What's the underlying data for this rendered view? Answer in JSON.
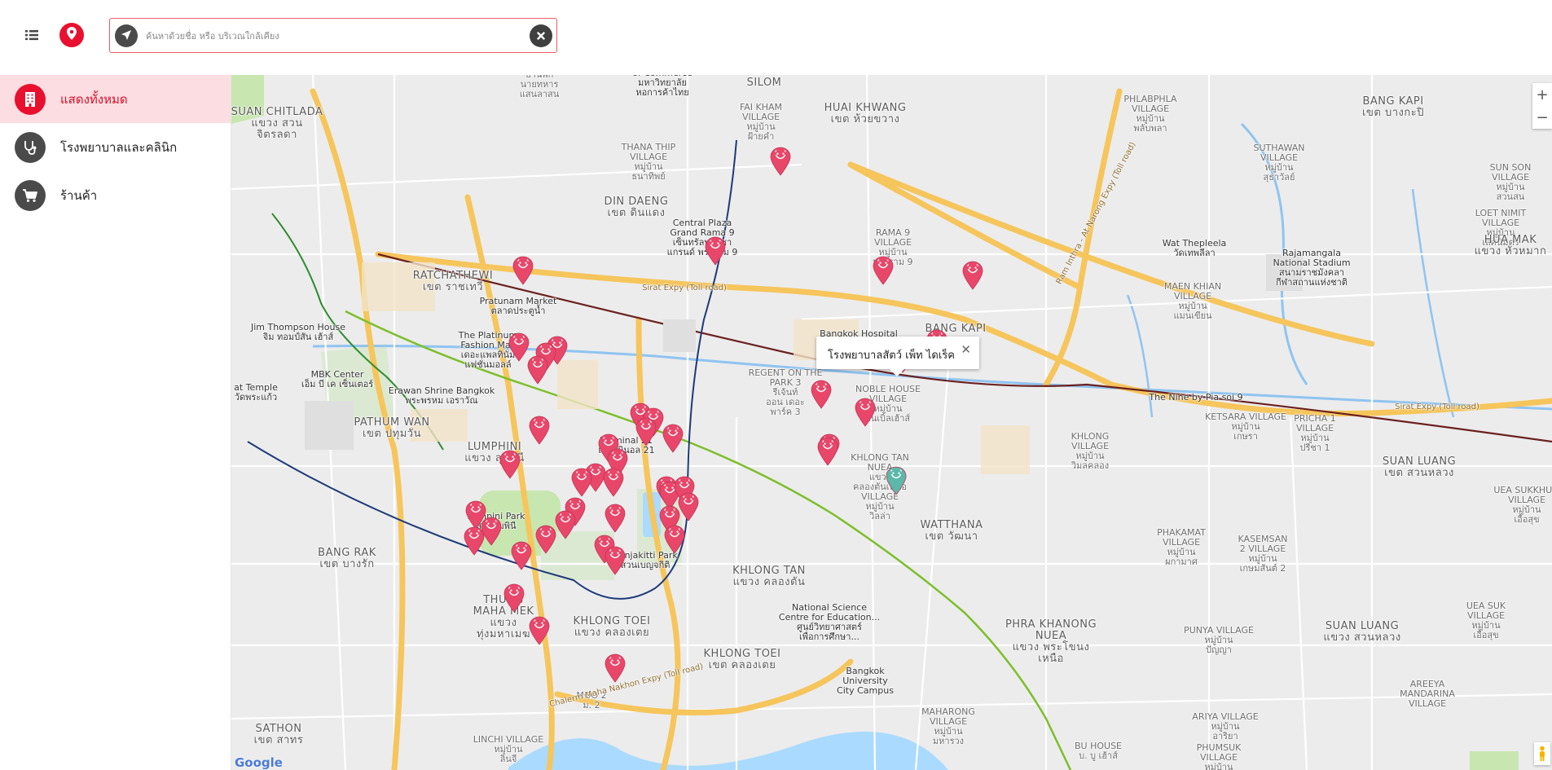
{
  "header": {
    "search_placeholder": "ค้นหาด้วยชื่อ หรือ บริเวณใกล้เคียง"
  },
  "sidebar": {
    "items": [
      {
        "label": "แสดงทั้งหมด",
        "icon": "building-icon",
        "active": true
      },
      {
        "label": "โรงพยาบาลและคลินิก",
        "icon": "stethoscope-icon",
        "active": false
      },
      {
        "label": "ร้านค้า",
        "icon": "cart-icon",
        "active": false
      }
    ]
  },
  "map": {
    "info_window_title": "โรงพยาบาลสัตว์ เพ็ท ไดเร็ค",
    "zoom_in": "+",
    "zoom_out": "−",
    "logo": "Google",
    "colors": {
      "marker": "#e8476a",
      "marker_selected": "#5cb8a8",
      "brand": "#e8102e",
      "highway": "#f6c55b",
      "water": "#aadaff"
    },
    "labels": {
      "silom": "SILOM",
      "village_top": "VILLAGE\nบ้านพัก\nนายทหาร\nแสนลาสน",
      "of_commerce": "of Commerce\nมหาวิทยาลัย\nหอการค้าไทย",
      "fai_kham": "FAI KHAM\nVILLAGE\nหมู่บ้าน\nฝ้ายคำ",
      "huai_khwang": "HUAI KHWANG\nเขต ห้วยขวาง",
      "phlabphla": "PHLABPHLA\nVILLAGE\nหมู่บ้าน\nพลับพลา",
      "bang_kapi_top": "BANG KAPI\nเขต บางกะปิ",
      "suan_chitlada": "SUAN CHITLADA\nแขวง สวน\nจิตรลดา",
      "thana_thip": "THANA THIP\nVILLAGE\nหมู่บ้าน\nธนาทิพย์",
      "suthawan": "SUTHAWAN\nVILLAGE\nหมู่บ้าน\nสุธาวัลย์",
      "sun_son": "SUN SON\nVILLAGE\nหมู่บ้าน\nสวนสน",
      "loet_nimit": "LOET NIMIT\nVILLAGE\nหมู่บ้าน\nเลิศนิมิตร",
      "din_daeng": "DIN DAENG\nเขต ดินแดง",
      "central_plaza": "Central Plaza\nGrand Rama 9\nเซ็นทรัลพลาซา\nแกรนด์ พระราม 9",
      "rama9_village": "RAMA 9\nVILLAGE\nหมู่บ้าน\nพระราม 9",
      "wat_thepleela": "Wat Thepleela\nวัดเทพลีลา",
      "rajamangala": "Rajamangala\nNational Stadium\nสนามราชมังคลา\nกีฬาสถานแห่งชาติ",
      "hua_mak": "HUA MAK\nแขวง หัวหมาก",
      "ratchathewi": "RATCHATHEWI\nเขต ราชเทวี",
      "pratunam": "Pratunam Market\nตลาดประตูน้ำ",
      "maen_khian": "MAEN KHIAN\nVILLAGE\nหมู่บ้าน\nแมนเขียน",
      "jim_thompson": "Jim Thompson House\nจิม ทอมป์สัน เฮ้าส์",
      "platinum": "The Platinum\nFashion Mall\nเดอะแพลทินั่ม\nแฟชั่นมอลล์",
      "bangkok_hospital": "Bangkok Hospital",
      "bang_kapi_mid": "BANG KAPI",
      "mbk": "MBK Center\nเอ็ม บี เค เซ็นเตอร์",
      "erawan": "Erawan Shrine Bangkok\nพระพรหม เอราวัณ",
      "regent": "REGENT ON THE\nPARK 3\nรีเจ้นท์\nออน เดอะ\nพาร์ค 3",
      "noble_house": "NOBLE HOUSE\nVILLAGE\nหมู่บ้าน\nโนเบิ้ลเฮ้าส์",
      "the_nine": "The Nine by Pia soi 9",
      "ketsara": "KETSARA VILLAGE\nหมู่บ้าน\nเกษรา",
      "pricha": "PRICHA 1\nVILLAGE\nหมู่บ้าน\nปรีชา 1",
      "suan_luang_top": "SUAN LUANG\nเขต สวนหลวง",
      "pathum_wan": "PATHUM WAN\nเขต ปทุมวัน",
      "lumphini": "LUMPHINI\nแขวง ลุมพินี",
      "terminal21": "Terminal 21\nเทอร์มินอล 21",
      "khlong_nuea": "KHLONG TAN\nNUEA\nแขวง\nคลองตันเหนือ\nVILLAGE\nหมู่บ้าน\nวิลล่า",
      "khlong_village": "KHLONG\nVILLAGE\nหมู่บ้าน\nวิมลคลอง",
      "ua_sukkhum": "UEA SUKKHUM\nVILLAGE\nหมู่บ้าน\nเอื้อสุข",
      "lumpini_park": "Lumpini Park\nสวนลุมพินี",
      "bang_rak": "BANG RAK\nเขต บางรัก",
      "benjakitti": "Benjakitti Park\nสวนเบญจกิติ",
      "watthana": "WATTHANA\nเขต วัฒนา",
      "phakamat": "PHAKAMAT\nVILLAGE\nหมู่บ้าน\nผกามาศ",
      "kasemsan": "KASEMSAN\n2 VILLAGE\nหมู่บ้าน\nเกษมสันต์ 2",
      "khlong_tan": "KHLONG TAN\nแขวง คลองตัน",
      "thung_maha_mek": "THUNG\nMAHA MEK\nแขวง\nทุ่งมหาเมฆ",
      "science_centre": "National Science\nCentre for Education...\nศูนย์วิทยาศาสตร์\nเพื่อการศึกษา...",
      "khlong_toei_left": "KHLONG TOEI\nแขวง คลองเตย",
      "khlong_toei": "KHLONG TOEI\nเขต คลองเตย",
      "phra_khanong": "PHRA KHANONG\nNUEA\nแขวง พระโขนง\nเหนือ",
      "punya": "PUNYA VILLAGE\nหมู่บ้าน\nปัญญา",
      "suan_luang_bot": "SUAN LUANG\nแขวง สวนหลวง",
      "uea_suk": "UEA SUK\nVILLAGE\nหมู่บ้าน\nเอื้อสุข",
      "bangkok_univ": "Bangkok\nUniversity\nCity Campus",
      "mahagong": "MAHARONG\nVILLAGE\nหมู่บ้าน\nมหารวง",
      "sathon": "SATHON\nเขต สาทร",
      "linchi": "LINCHI VILLAGE\nหมู่บ้าน\nลินจี",
      "moo2": "MOO 2\nม. 2",
      "ariya": "ARIYA VILLAGE\nหมู่บ้าน\nอาริยา",
      "areeya": "AREEYA\nMANDARINA\nVILLAGE",
      "bu_house": "BU HOUSE\nบ. บู เฮ้าส์",
      "phumsuk": "PHUMSUK\nVILLAGE\nหมู่บ้าน",
      "temple": "at Temple\nวัดพระแก้ว",
      "sirat_expy": "Sirat Expy (Toll road)",
      "sirat_expy2": "Sirat Expy (Toll road)",
      "chalerm": "Chalerm Maha Nakhon Expy (Toll road)",
      "ram_inthra": "Ram Inthra - At Narong Expy (Toll road)"
    }
  }
}
